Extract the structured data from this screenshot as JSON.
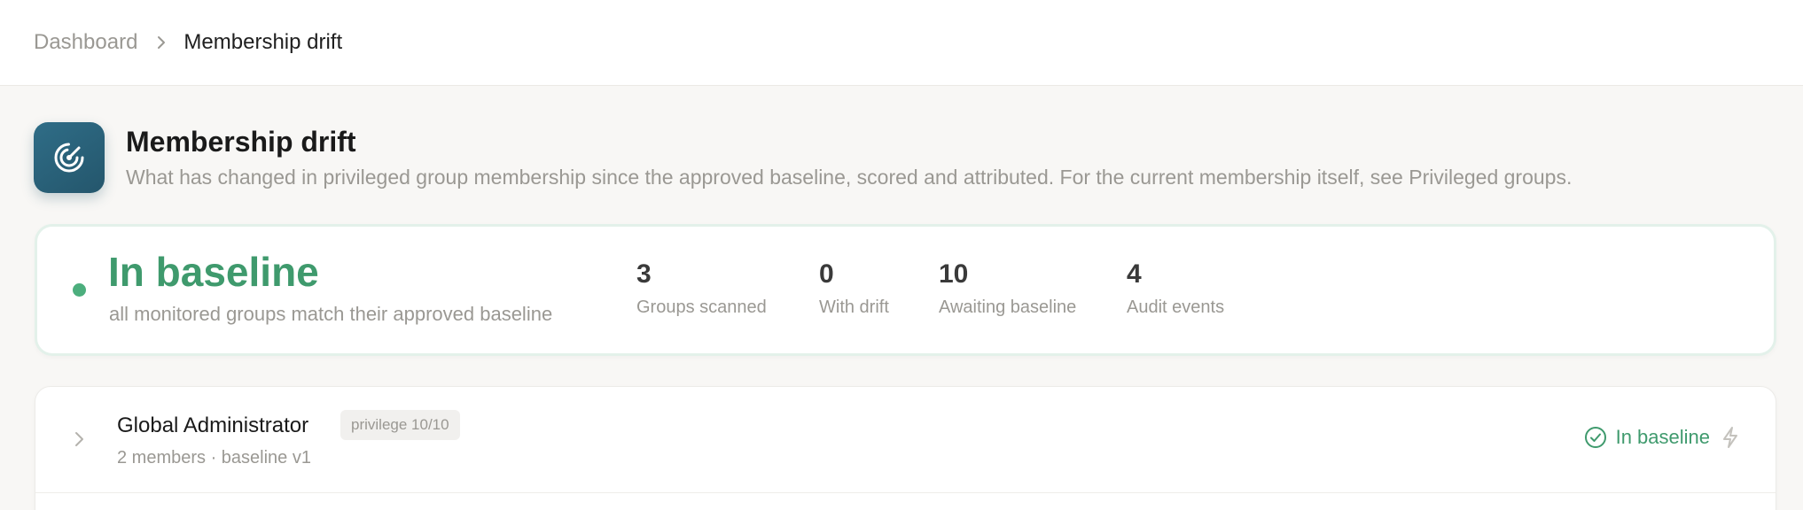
{
  "breadcrumb": {
    "root": "Dashboard",
    "current": "Membership drift",
    "separator_icon": "chevron-right-icon"
  },
  "header": {
    "title": "Membership drift",
    "subtitle": "What has changed in privileged group membership since the approved baseline, scored and attributed. For the current membership itself, see Privileged groups.",
    "icon": "radar-icon",
    "icon_color": "#2f6d87"
  },
  "status": {
    "title": "In baseline",
    "subtitle": "all monitored groups match their approved baseline",
    "color": "#3f9a6d",
    "stats": [
      {
        "value": "3",
        "label": "Groups scanned"
      },
      {
        "value": "0",
        "label": "With drift"
      },
      {
        "value": "10",
        "label": "Awaiting baseline"
      },
      {
        "value": "4",
        "label": "Audit events"
      }
    ]
  },
  "groups": [
    {
      "name": "Global Administrator",
      "badge": "privilege 10/10",
      "meta": "2 members · baseline v1",
      "status": "In baseline",
      "status_icon": "check-circle-icon",
      "action_icon": "bolt-icon"
    }
  ]
}
